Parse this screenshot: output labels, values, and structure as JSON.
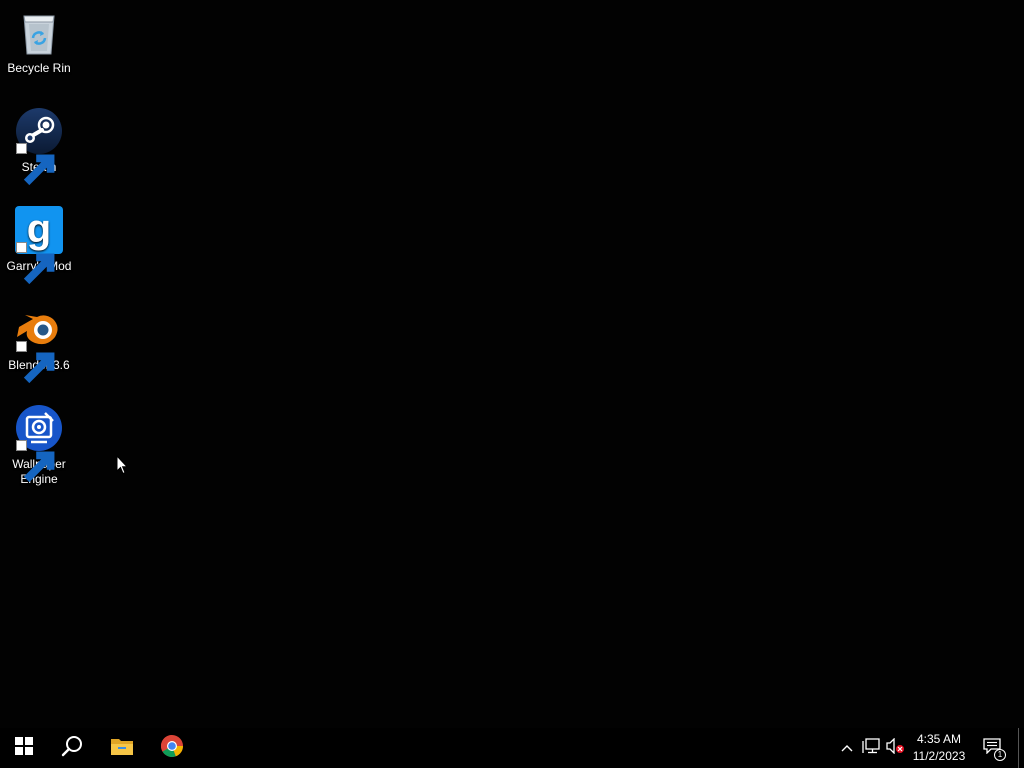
{
  "desktop": {
    "icons": [
      {
        "label": "Becycle Rin",
        "icon": "recycle-bin-icon"
      },
      {
        "label": "Steam",
        "icon": "steam-icon"
      },
      {
        "label": "Garry's Mod",
        "icon": "garrys-mod-icon"
      },
      {
        "label": "Blender 3.6",
        "icon": "blender-icon"
      },
      {
        "label": "Wallpaper Engine",
        "icon": "wallpaper-engine-icon"
      }
    ]
  },
  "taskbar": {
    "pinned": [
      {
        "icon": "windows-start-icon"
      },
      {
        "icon": "search-icon"
      },
      {
        "icon": "file-explorer-icon"
      },
      {
        "icon": "chrome-icon"
      }
    ],
    "tray": {
      "icons": [
        "show-hidden-icons-chevron-icon",
        "network-icon",
        "volume-muted-icon"
      ],
      "time": "4:35 AM",
      "date": "11/2/2023",
      "notification_count": "1"
    }
  },
  "colors": {
    "desktop_background": "#020202",
    "taskbar_background": "#000000",
    "gmod_blue": "#1194f0",
    "blender_orange": "#e87d0d",
    "steam_navy": "#1b2a4a"
  }
}
